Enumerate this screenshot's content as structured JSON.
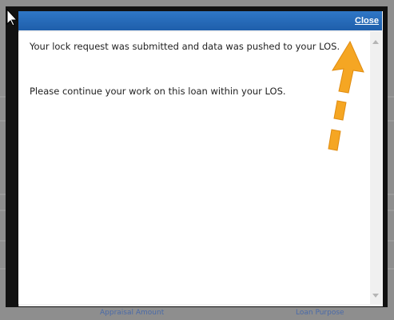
{
  "dialog": {
    "close_label": "Close",
    "message_line1": "Your lock request was submitted and data was pushed to your LOS.",
    "message_line2": "Please continue your work on this loan within your LOS."
  },
  "background": {
    "label_left": "Appraisal Amount",
    "label_right": "Loan Purpose"
  },
  "colors": {
    "titlebar": "#2468b7",
    "annotation_arrow": "#f5a623"
  },
  "icons": {
    "cursor": "mouse-pointer-icon",
    "arrow": "annotation-arrow-icon"
  }
}
